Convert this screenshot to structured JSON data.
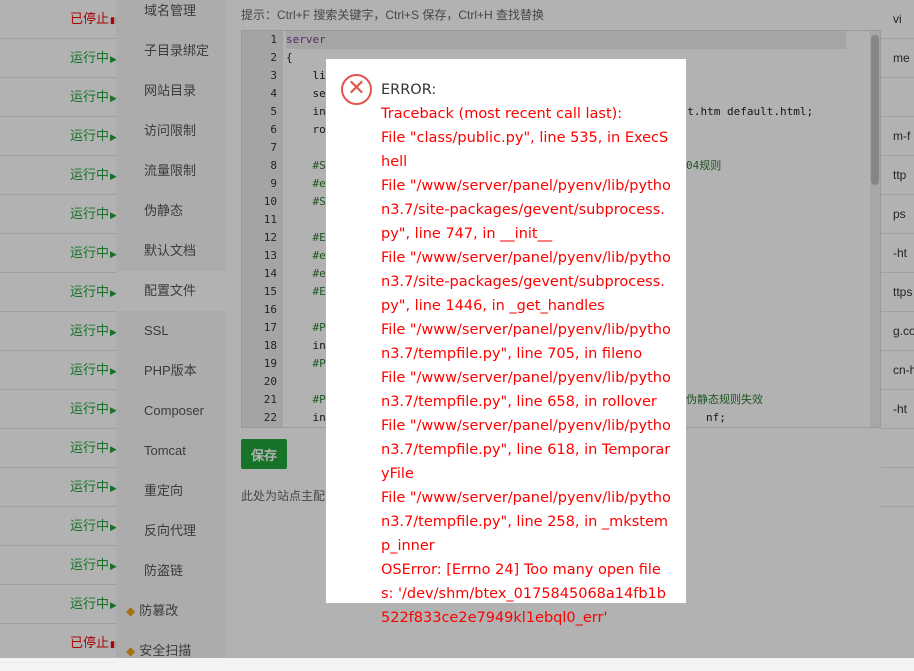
{
  "site_list": {
    "rows": [
      {
        "status": "已停止",
        "icon": "pause-icon"
      },
      {
        "status": "运行中",
        "icon": "play-icon"
      },
      {
        "status": "运行中",
        "icon": "play-icon"
      },
      {
        "status": "运行中",
        "icon": "play-icon"
      },
      {
        "status": "运行中",
        "icon": "play-icon"
      },
      {
        "status": "运行中",
        "icon": "play-icon"
      },
      {
        "status": "运行中",
        "icon": "play-icon"
      },
      {
        "status": "运行中",
        "icon": "play-icon"
      },
      {
        "status": "运行中",
        "icon": "play-icon"
      },
      {
        "status": "运行中",
        "icon": "play-icon"
      },
      {
        "status": "运行中",
        "icon": "play-icon"
      },
      {
        "status": "运行中",
        "icon": "play-icon"
      },
      {
        "status": "运行中",
        "icon": "play-icon"
      },
      {
        "status": "运行中",
        "icon": "play-icon"
      },
      {
        "status": "运行中",
        "icon": "play-icon"
      },
      {
        "status": "运行中",
        "icon": "play-icon"
      },
      {
        "status": "已停止",
        "icon": "pause-icon"
      }
    ],
    "status_colors": {
      "running": "#20a53a",
      "stopped": "#ef0808"
    }
  },
  "right_column": [
    "vi",
    "me",
    "",
    "m-f",
    "ttp",
    "ps",
    "-ht",
    "ttps",
    "g.co",
    "cn-h",
    "-ht",
    "",
    ""
  ],
  "side_menu": {
    "items": [
      {
        "label": "域名管理"
      },
      {
        "label": "子目录绑定"
      },
      {
        "label": "网站目录"
      },
      {
        "label": "访问限制"
      },
      {
        "label": "流量限制"
      },
      {
        "label": "伪静态"
      },
      {
        "label": "默认文档"
      },
      {
        "label": "配置文件"
      },
      {
        "label": "SSL"
      },
      {
        "label": "PHP版本"
      },
      {
        "label": "Composer"
      },
      {
        "label": "Tomcat"
      },
      {
        "label": "重定向"
      },
      {
        "label": "反向代理"
      },
      {
        "label": "防盗链"
      },
      {
        "label": "防篡改"
      },
      {
        "label": "安全扫描"
      }
    ],
    "active": "配置文件"
  },
  "editor": {
    "hint": "提示：Ctrl+F 搜索关键字，Ctrl+S 保存，Ctrl+H 查找替换",
    "line_numbers": [
      "1",
      "2",
      "3",
      "4",
      "5",
      "6",
      "7",
      "8",
      "9",
      "10",
      "11",
      "12",
      "13",
      "14",
      "15",
      "16",
      "17",
      "18",
      "19",
      "20",
      "21",
      "22"
    ],
    "lines": [
      "server",
      "{",
      "    li",
      "    se",
      "    in",
      "    ro",
      "",
      "    #S",
      "    #e",
      "    #S",
      "",
      "    #E",
      "    #e",
      "    #e",
      "    #E",
      "",
      "    #P",
      "    in",
      "    #P",
      "",
      "    #P",
      "    in"
    ],
    "right_fragments": {
      "line5": "ult.htm default.html;",
      "line8": "04规则",
      "line21": "伪静态规则失效",
      "line22": "nf;"
    }
  },
  "save_button": "保存",
  "footer_note": "此处为站点主配",
  "error_dialog": {
    "title": "ERROR:",
    "icon": "error-circle-x-icon",
    "lines": [
      "Traceback (most recent call last):",
      "File \"class/public.py\", line 535, in ExecShell",
      "File \"/www/server/panel/pyenv/lib/python3.7/site-packages/gevent/subprocess.py\", line 747, in __init__",
      "File \"/www/server/panel/pyenv/lib/python3.7/site-packages/gevent/subprocess.py\", line 1446, in _get_handles",
      "File \"/www/server/panel/pyenv/lib/python3.7/tempfile.py\", line 705, in fileno",
      "File \"/www/server/panel/pyenv/lib/python3.7/tempfile.py\", line 658, in rollover",
      "File \"/www/server/panel/pyenv/lib/python3.7/tempfile.py\", line 618, in TemporaryFile",
      "File \"/www/server/panel/pyenv/lib/python3.7/tempfile.py\", line 258, in _mkstemp_inner",
      "OSError: [Errno 24] Too many open files: '/dev/shm/btex_0175845068a14fb1b522f833ce2e7949kl1ebql0_err'"
    ],
    "text_color": "#ff0000"
  }
}
